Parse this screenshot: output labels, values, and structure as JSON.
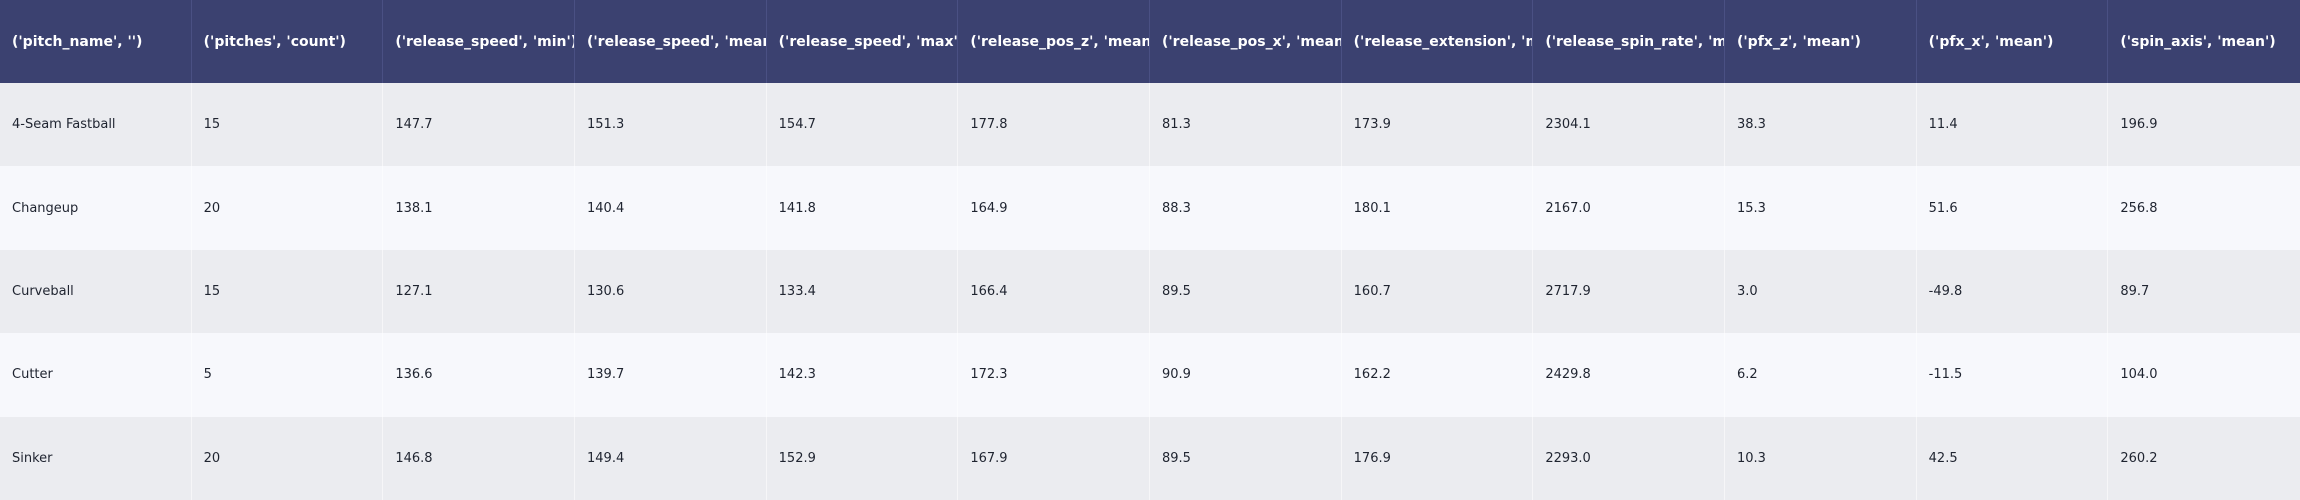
{
  "table": {
    "columns": [
      "('pitch_name', '')",
      "('pitches', 'count')",
      "('release_speed', 'min')",
      "('release_speed', 'mean')",
      "('release_speed', 'max')",
      "('release_pos_z', 'mean')",
      "('release_pos_x', 'mean')",
      "('release_extension', 'mean')",
      "('release_spin_rate', 'mean')",
      "('pfx_z', 'mean')",
      "('pfx_x', 'mean')",
      "('spin_axis', 'mean')"
    ],
    "rows": [
      [
        "4-Seam Fastball",
        "15",
        "147.7",
        "151.3",
        "154.7",
        "177.8",
        "81.3",
        "173.9",
        "2304.1",
        "38.3",
        "11.4",
        "196.9"
      ],
      [
        "Changeup",
        "20",
        "138.1",
        "140.4",
        "141.8",
        "164.9",
        "88.3",
        "180.1",
        "2167.0",
        "15.3",
        "51.6",
        "256.8"
      ],
      [
        "Curveball",
        "15",
        "127.1",
        "130.6",
        "133.4",
        "166.4",
        "89.5",
        "160.7",
        "2717.9",
        "3.0",
        "-49.8",
        "89.7"
      ],
      [
        "Cutter",
        "5",
        "136.6",
        "139.7",
        "142.3",
        "172.3",
        "90.9",
        "162.2",
        "2429.8",
        "6.2",
        "-11.5",
        "104.0"
      ],
      [
        "Sinker",
        "20",
        "146.8",
        "149.4",
        "152.9",
        "167.9",
        "89.5",
        "176.9",
        "2293.0",
        "10.3",
        "42.5",
        "260.2"
      ]
    ]
  }
}
